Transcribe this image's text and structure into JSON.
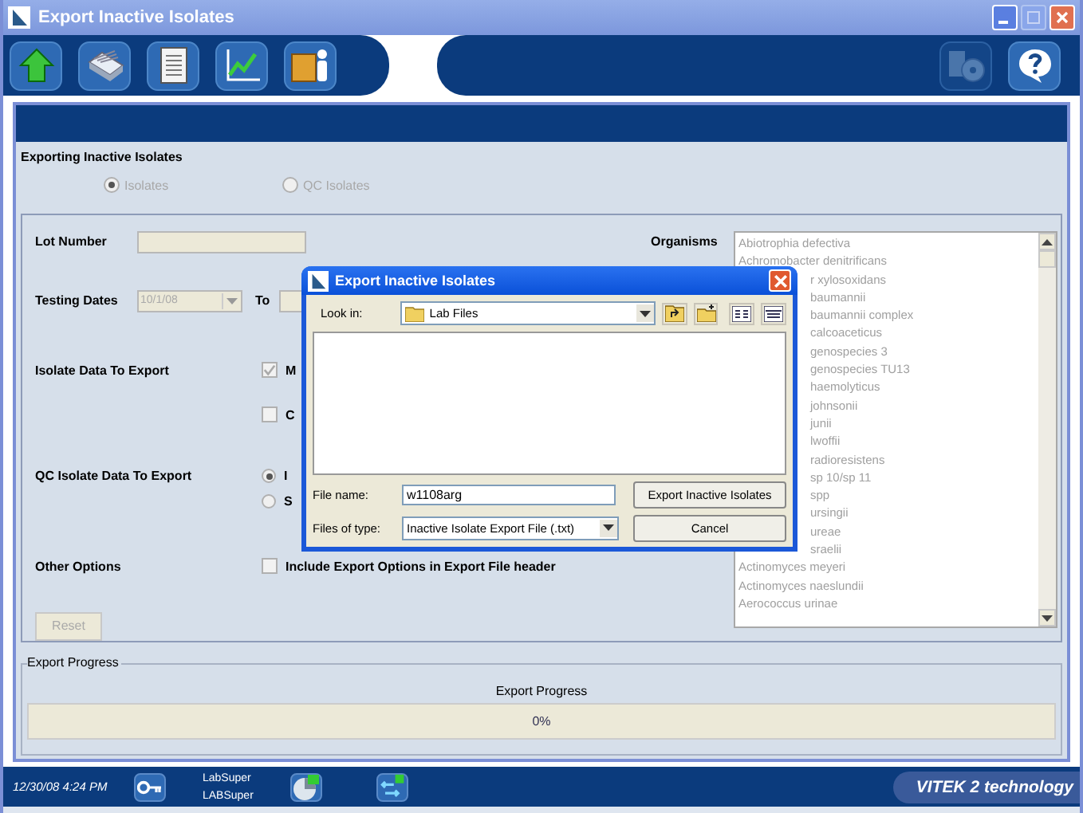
{
  "window": {
    "title": "Export Inactive Isolates"
  },
  "toolbar": {
    "left_buttons": [
      {
        "kind": "home",
        "disabled": false
      },
      {
        "kind": "cards",
        "disabled": false
      },
      {
        "kind": "document",
        "disabled": false
      },
      {
        "kind": "chart",
        "disabled": false
      },
      {
        "kind": "folder-person",
        "disabled": false
      }
    ],
    "right_buttons": [
      {
        "kind": "disc",
        "disabled": true
      },
      {
        "kind": "help",
        "disabled": false
      }
    ]
  },
  "section": {
    "title": "Exporting Inactive Isolates",
    "disabled": true,
    "options": [
      {
        "label": "Isolates",
        "selected": true
      },
      {
        "label": "QC Isolates",
        "selected": false
      }
    ]
  },
  "form": {
    "disabled": true,
    "lot_number": {
      "label": "Lot Number"
    },
    "testing_dates": {
      "label": "Testing Dates",
      "from": "10/1/08",
      "to_label": "To"
    },
    "isolate_data": {
      "label": "Isolate Data To Export",
      "options": [
        {
          "label": "M",
          "checked": true
        },
        {
          "label": "C",
          "checked": false
        }
      ]
    },
    "qc_data": {
      "label": "QC Isolate Data To Export",
      "options": [
        {
          "label": "I",
          "selected": true
        },
        {
          "label": "S",
          "selected": false
        }
      ]
    },
    "other_options": {
      "label": "Other Options",
      "options": [
        {
          "label": "Include Export Options in Export File header",
          "checked": false
        }
      ]
    },
    "reset_button": "Reset",
    "organisms": {
      "label": "Organisms",
      "items": [
        {
          "text": "Abiotrophia defectiva",
          "clipped": false
        },
        {
          "text": "Achromobacter denitrificans",
          "clipped": false
        },
        {
          "text": "r xylosoxidans",
          "clipped": true
        },
        {
          "text": "baumannii",
          "clipped": true
        },
        {
          "text": "baumannii complex",
          "clipped": true
        },
        {
          "text": "calcoaceticus",
          "clipped": true
        },
        {
          "text": "genospecies 3",
          "clipped": true
        },
        {
          "text": "genospecies TU13",
          "clipped": true
        },
        {
          "text": "haemolyticus",
          "clipped": true
        },
        {
          "text": "johnsonii",
          "clipped": true
        },
        {
          "text": "junii",
          "clipped": true
        },
        {
          "text": "lwoffii",
          "clipped": true
        },
        {
          "text": "radioresistens",
          "clipped": true
        },
        {
          "text": "sp 10/sp 11",
          "clipped": true
        },
        {
          "text": "spp",
          "clipped": true
        },
        {
          "text": "ursingii",
          "clipped": true
        },
        {
          "text": "ureae",
          "clipped": true
        },
        {
          "text": "sraelii",
          "clipped": true
        },
        {
          "text": "Actinomyces meyeri",
          "clipped": false
        },
        {
          "text": "Actinomyces naeslundii",
          "clipped": false
        },
        {
          "text": "Aerococcus urinae",
          "clipped": false
        }
      ]
    }
  },
  "progress": {
    "title": "Export Progress",
    "label": "Export Progress",
    "level": 0,
    "reading": "0%"
  },
  "status_bar": {
    "datetime": "12/30/08 4:24 PM",
    "user": "LabSuper",
    "user_full": "LABSuper",
    "brand": "VITEK 2 technology"
  },
  "dialog": {
    "title": "Export Inactive Isolates",
    "look_in_label": "Look in:",
    "look_in": "Lab Files",
    "file_name_label": "File name:",
    "file_name": "w1108arg",
    "file_type_label": "Files of type:",
    "file_type": "Inactive Isolate Export File (.txt)",
    "buttons": [
      "Export Inactive Isolates",
      "Cancel"
    ]
  }
}
